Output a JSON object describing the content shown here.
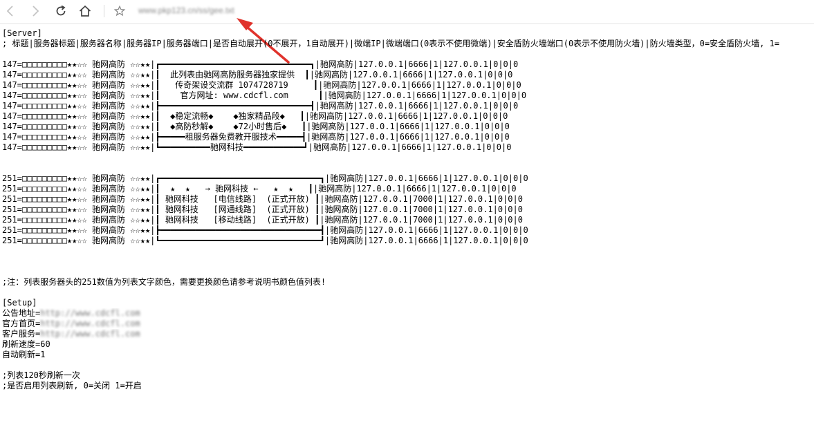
{
  "browser": {
    "back_icon": "chevron-left-icon",
    "forward_icon": "chevron-right-icon",
    "reload_icon": "reload-icon",
    "home_icon": "home-icon",
    "star_icon": "star-outline-icon",
    "url": "www.pkp123.cn/ss/gee.txt",
    "annotation_color": "#e0322b"
  },
  "file": {
    "server_header": "[Server]",
    "server_comment": "; 标题|服务器标题|服务器名称|服务器IP|服务器端口|是否自动展开(0不展开，1自动展开)|微端IP|微端端口(0表示不使用微端)|安全盾防火墙端口(0表示不使用防火墙)|防火墙类型，0=安全盾防火墙, 1=",
    "group1": [
      "147=□□□□□□□□□★★☆☆ 驰网高防 ☆☆★★|┏━━━━━━━━━━━━━━━━━━━━━━━━━━━━━━┓|驰网高防|127.0.0.1|6666|1|127.0.0.1|0|0|0",
      "147=□□□□□□□□□★★☆☆ 驰网高防 ☆☆★★|┃  此列表由驰网高防服务器独家提供  ┃|驰网高防|127.0.0.1|6666|1|127.0.0.1|0|0|0",
      "147=□□□□□□□□□★★☆☆ 驰网高防 ☆☆★★|┃   传奇架设交流群 1074728719     ┃|驰网高防|127.0.0.1|6666|1|127.0.0.1|0|0|0",
      "147=□□□□□□□□□★★☆☆ 驰网高防 ☆☆★★|┃    官方网址: www.cdcfl.com      ┃|驰网高防|127.0.0.1|6666|1|127.0.0.1|0|0|0",
      "147=□□□□□□□□□★★☆☆ 驰网高防 ☆☆★★|┣━━━━━━━━━━━━━━━━━━━━━━━━━━━━━━┫|驰网高防|127.0.0.1|6666|1|127.0.0.1|0|0|0",
      "147=□□□□□□□□□★★☆☆ 驰网高防 ☆☆★★|┃  ◆稳定流畅◆    ◆独家精品段◆   ┃|驰网高防|127.0.0.1|6666|1|127.0.0.1|0|0|0",
      "147=□□□□□□□□□★★☆☆ 驰网高防 ☆☆★★|┃  ◆高防秒解◆    ◆72小时售后◆   ┃|驰网高防|127.0.0.1|6666|1|127.0.0.1|0|0|0",
      "147=□□□□□□□□□★★☆☆ 驰网高防 ☆☆★★|┣━━━━━租服务器免费教开服技术━━━━━┫|驰网高防|127.0.0.1|6666|1|127.0.0.1|0|0|0",
      "147=□□□□□□□□□★★☆☆ 驰网高防 ☆☆★★|┗━━━━━━━━━━驰网科技━━━━━━━━━━━━┛|驰网高防|127.0.0.1|6666|1|127.0.0.1|0|0|0"
    ],
    "group2": [
      "251=□□□□□□□□□★★☆☆ 驰网高防 ☆☆★★|┏━━━━━━━━━━━━━━━━━━━━━━━━━━━━━━━━┓|驰网高防|127.0.0.1|6666|1|127.0.0.1|0|0|0",
      "251=□□□□□□□□□★★☆☆ 驰网高防 ☆☆★★|┃  ★  ★   → 驰网科技 ←   ★  ★   ┃|驰网高防|127.0.0.1|6666|1|127.0.0.1|0|0|0",
      "251=□□□□□□□□□★★☆☆ 驰网高防 ☆☆★★|┃ 驰网科技   [电信线路]  (正式开放) ┃|驰网高防|127.0.0.1|7000|1|127.0.0.1|0|0|0",
      "251=□□□□□□□□□★★☆☆ 驰网高防 ☆☆★★|┃ 驰网科技   [网通线路]  (正式开放) ┃|驰网高防|127.0.0.1|7000|1|127.0.0.1|0|0|0",
      "251=□□□□□□□□□★★☆☆ 驰网高防 ☆☆★★|┃ 驰网科技   [移动线路]  (正式开放) ┃|驰网高防|127.0.0.1|7000|1|127.0.0.1|0|0|0",
      "251=□□□□□□□□□★★☆☆ 驰网高防 ☆☆★★|┣━━━━━━━━━━━━━━━━━━━━━━━━━━━━━━━━┫|驰网高防|127.0.0.1|6666|1|127.0.0.1|0|0|0",
      "251=□□□□□□□□□★★☆☆ 驰网高防 ☆☆★★|┗━━━━━━━━━━━━━━━━━━━━━━━━━━━━━━━━┛|驰网高防|127.0.0.1|6666|1|127.0.0.1|0|0|0"
    ],
    "note": ";注：列表服务器头的251数值为列表文字颜色，需要更换颜色请参考说明书颜色值列表!",
    "setup_header": "[Setup]",
    "setup": [
      {
        "key": "公告地址=",
        "value": "http://www.cdcfl.com",
        "blurred": true
      },
      {
        "key": "官方首页=",
        "value": "http://www.cdcfl.com",
        "blurred": true
      },
      {
        "key": "客户服务=",
        "value": "http://www.cdcfl.com",
        "blurred": true
      },
      {
        "key": "刷新速度=60",
        "value": "",
        "blurred": false
      },
      {
        "key": "自动刷新=1",
        "value": "",
        "blurred": false
      }
    ],
    "comment1": ";列表120秒刷新一次",
    "comment2": ";是否启用列表刷新, 0=关闭 1=开启"
  }
}
